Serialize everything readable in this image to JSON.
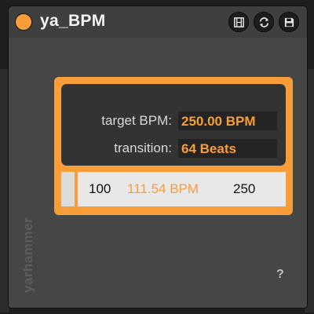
{
  "device": {
    "title": "ya_BPM",
    "vendor": "yarhammer",
    "help_label": "?",
    "header_icons": [
      "preset-icon",
      "refresh-icon",
      "save-icon"
    ]
  },
  "settings": {
    "target_label": "target BPM:",
    "target_value": "250.00 BPM",
    "transition_label": "transition:",
    "transition_value": "64 Beats"
  },
  "range": {
    "min": "100",
    "current": "111.54 BPM",
    "max": "250"
  },
  "colors": {
    "accent": "#f79e3b",
    "device_bg": "#464646",
    "panel_inner": "#333333",
    "range_bg": "#e8e8e8"
  }
}
